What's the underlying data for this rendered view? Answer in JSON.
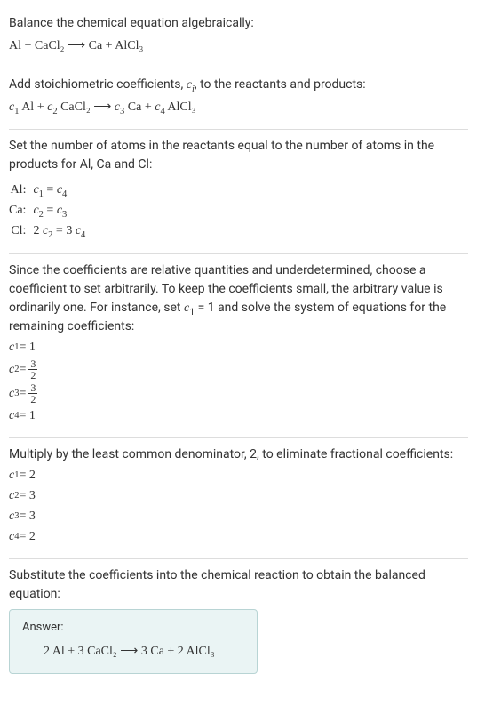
{
  "section1": {
    "title": "Balance the chemical equation algebraically:",
    "equation": "Al + CaCl₂  ⟶  Ca + AlCl₃"
  },
  "section2": {
    "intro_a": "Add stoichiometric coefficients, ",
    "intro_var": "c",
    "intro_sub": "i",
    "intro_b": ", to the reactants and products:",
    "eq_c1": "c",
    "eq_c1s": "1",
    "eq_sp1": " Al + ",
    "eq_c2": "c",
    "eq_c2s": "2",
    "eq_sp2": " CaCl₂  ⟶  ",
    "eq_c3": "c",
    "eq_c3s": "3",
    "eq_sp3": " Ca + ",
    "eq_c4": "c",
    "eq_c4s": "4",
    "eq_sp4": " AlCl₃"
  },
  "section3": {
    "intro": "Set the number of atoms in the reactants equal to the number of atoms in the products for Al, Ca and Cl:",
    "rows": [
      {
        "el": "Al:",
        "lhs_c": "c",
        "lhs_s": "1",
        "eq": " = ",
        "rhs_c": "c",
        "rhs_s": "4",
        "pre": ""
      },
      {
        "el": "Ca:",
        "lhs_c": "c",
        "lhs_s": "2",
        "eq": " = ",
        "rhs_c": "c",
        "rhs_s": "3",
        "pre": ""
      },
      {
        "el": "Cl:",
        "lhs_c": "c",
        "lhs_s": "2",
        "eq": " = 3 ",
        "rhs_c": "c",
        "rhs_s": "4",
        "pre": "2 "
      }
    ]
  },
  "section4": {
    "intro_a": "Since the coefficients are relative quantities and underdetermined, choose a coefficient to set arbitrarily. To keep the coefficients small, the arbitrary value is ordinarily one. For instance, set ",
    "intro_var": "c",
    "intro_sub": "1",
    "intro_b": " = 1 and solve the system of equations for the remaining coefficients:",
    "c1_label": "c",
    "c1_sub": "1",
    "c1_val": " = 1",
    "c2_label": "c",
    "c2_sub": "2",
    "c2_eq": " = ",
    "c2_num": "3",
    "c2_den": "2",
    "c3_label": "c",
    "c3_sub": "3",
    "c3_eq": " = ",
    "c3_num": "3",
    "c3_den": "2",
    "c4_label": "c",
    "c4_sub": "4",
    "c4_val": " = 1"
  },
  "section5": {
    "intro": "Multiply by the least common denominator, 2, to eliminate fractional coefficients:",
    "c1_label": "c",
    "c1_sub": "1",
    "c1_val": " = 2",
    "c2_label": "c",
    "c2_sub": "2",
    "c2_val": " = 3",
    "c3_label": "c",
    "c3_sub": "3",
    "c3_val": " = 3",
    "c4_label": "c",
    "c4_sub": "4",
    "c4_val": " = 2"
  },
  "section6": {
    "intro": "Substitute the coefficients into the chemical reaction to obtain the balanced equation:",
    "answer_label": "Answer:",
    "answer_eq": "2 Al + 3 CaCl₂  ⟶  3 Ca + 2 AlCl₃"
  }
}
